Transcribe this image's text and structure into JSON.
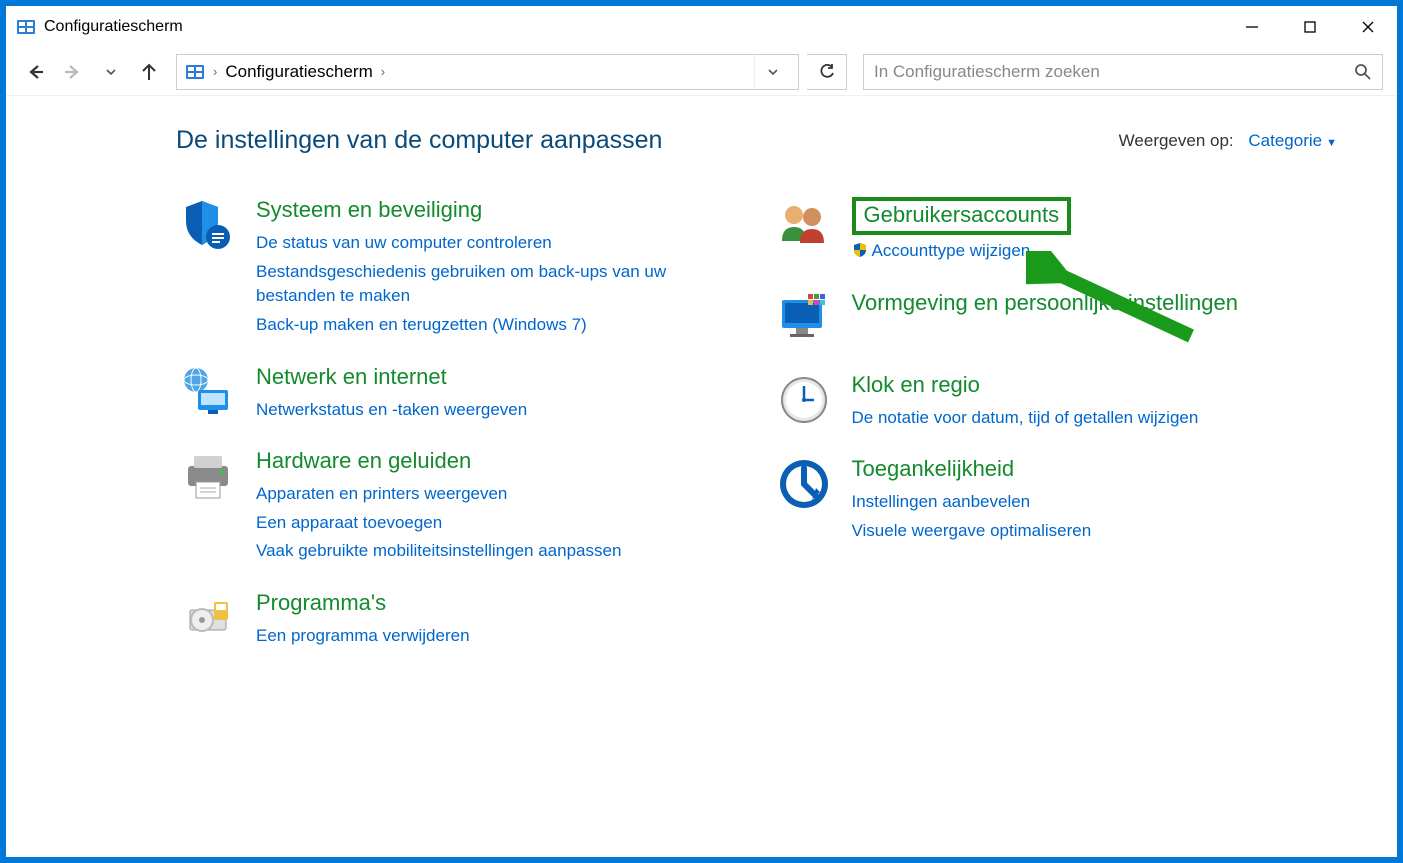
{
  "titlebar": {
    "title": "Configuratiescherm"
  },
  "breadcrumb": {
    "text": "Configuratiescherm"
  },
  "search": {
    "placeholder": "In Configuratiescherm zoeken"
  },
  "header": {
    "title": "De instellingen van de computer aanpassen",
    "view_label": "Weergeven op:",
    "view_value": "Categorie"
  },
  "left": [
    {
      "title": "Systeem en beveiliging",
      "links": [
        "De status van uw computer controleren",
        "Bestandsgeschiedenis gebruiken om back-ups van uw bestanden te maken",
        "Back-up maken en terugzetten (Windows 7)"
      ]
    },
    {
      "title": "Netwerk en internet",
      "links": [
        "Netwerkstatus en -taken weergeven"
      ]
    },
    {
      "title": "Hardware en geluiden",
      "links": [
        "Apparaten en printers weergeven",
        "Een apparaat toevoegen",
        "Vaak gebruikte mobiliteitsinstellingen aanpassen"
      ]
    },
    {
      "title": "Programma's",
      "links": [
        "Een programma verwijderen"
      ]
    }
  ],
  "right": [
    {
      "title": "Gebruikersaccounts",
      "links": [
        "Accounttype wijzigen"
      ],
      "highlighted": true,
      "shield": true
    },
    {
      "title": "Vormgeving en persoonlijke instellingen",
      "links": []
    },
    {
      "title": "Klok en regio",
      "links": [
        "De notatie voor datum, tijd of getallen wijzigen"
      ]
    },
    {
      "title": "Toegankelijkheid",
      "links": [
        "Instellingen aanbevelen",
        "Visuele weergave optimaliseren"
      ]
    }
  ]
}
